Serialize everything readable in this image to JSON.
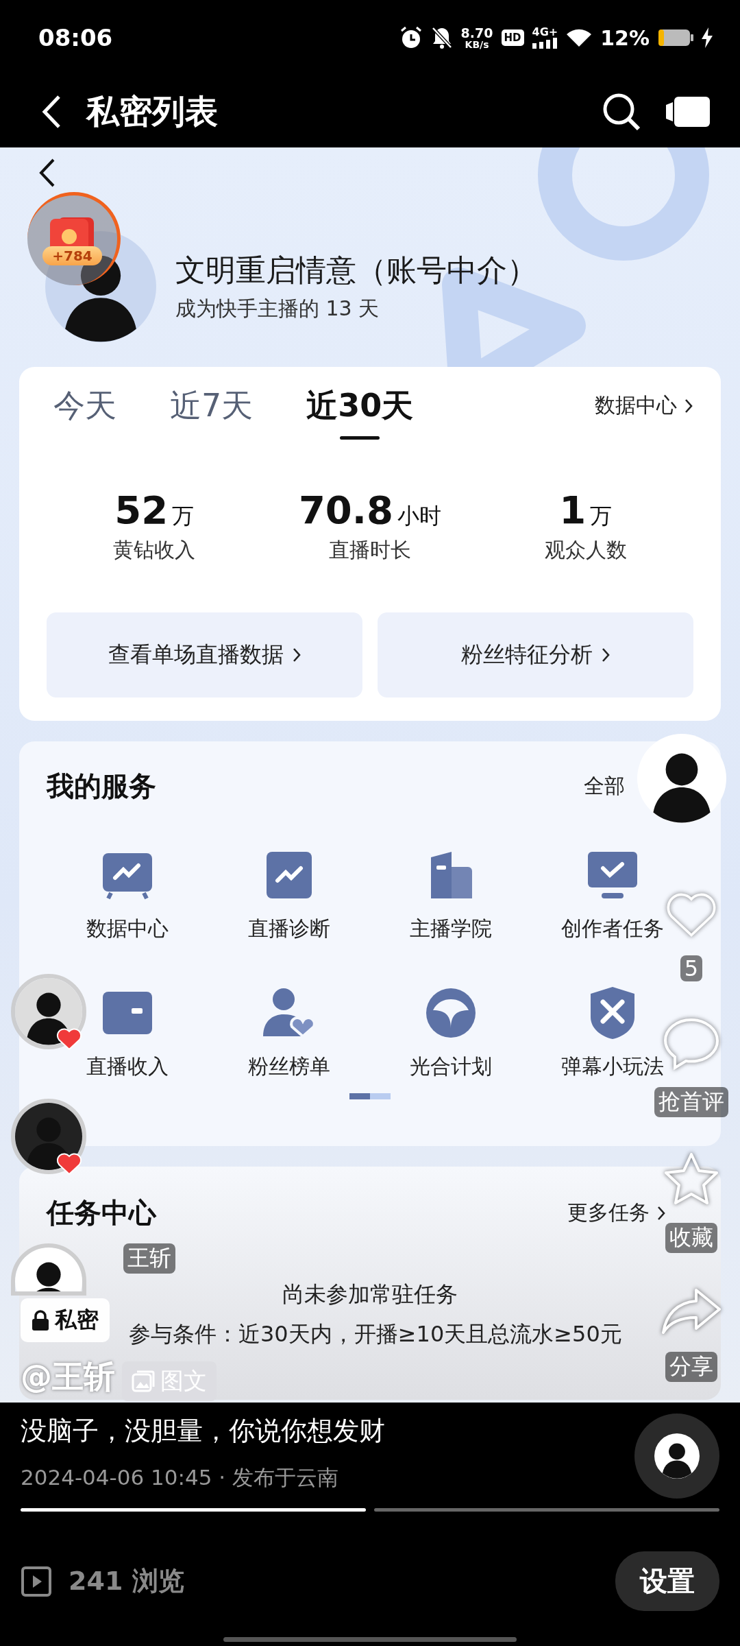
{
  "status_bar": {
    "time": "08:06",
    "net_speed": "8.70",
    "net_speed_unit": "KB/s",
    "hd": "HD",
    "network": "4G+",
    "battery": "12%"
  },
  "top_bar": {
    "title": "私密列表"
  },
  "post_image": {
    "profile": {
      "badge": "+784",
      "name": "文明重启情意（账号中介）",
      "subtitle": "成为快手主播的 13 天"
    },
    "stats_card": {
      "tabs": [
        {
          "label": "今天",
          "selected": false
        },
        {
          "label": "近7天",
          "selected": false
        },
        {
          "label": "近30天",
          "selected": true
        }
      ],
      "link": "数据中心",
      "metrics": [
        {
          "value": "52",
          "unit": "万",
          "label": "黄钻收入"
        },
        {
          "value": "70.8",
          "unit": "小时",
          "label": "直播时长"
        },
        {
          "value": "1",
          "unit": "万",
          "label": "观众人数"
        }
      ],
      "buttons": [
        "查看单场直播数据",
        "粉丝特征分析"
      ]
    },
    "services": {
      "title": "我的服务",
      "link": "全部",
      "items": [
        {
          "kind": "chart-screen",
          "label": "数据中心"
        },
        {
          "kind": "chart",
          "label": "直播诊断"
        },
        {
          "kind": "building",
          "label": "主播学院"
        },
        {
          "kind": "monitor-check",
          "label": "创作者任务"
        },
        {
          "kind": "card",
          "label": "直播收入"
        },
        {
          "kind": "user-heart",
          "label": "粉丝榜单"
        },
        {
          "kind": "circle-leaf",
          "label": "光合计划"
        },
        {
          "kind": "shield",
          "label": "弹幕小玩法"
        }
      ],
      "pages": [
        {
          "selected": true
        },
        {
          "selected": false
        }
      ]
    },
    "task_center": {
      "title": "任务中心",
      "link": "更多任务",
      "message": "尚未参加常驻任务",
      "condition": "参与条件：近30天内，开播≥10天且总流水≥50元"
    }
  },
  "overlay": {
    "viewer_name": "王斩",
    "privacy": "私密",
    "author": "@王斩",
    "post_type": "图文",
    "actions": [
      {
        "kind": "like",
        "label": "5"
      },
      {
        "kind": "comment",
        "label": "抢首评"
      },
      {
        "kind": "favorite",
        "label": "收藏"
      },
      {
        "kind": "share",
        "label": "分享"
      }
    ]
  },
  "caption": "没脑子，没胆量，你说你想发财",
  "meta": "2024-04-06 10:45 · 发布于云南",
  "slides": [
    {
      "selected": true
    },
    {
      "selected": false
    }
  ],
  "views": "241 浏览",
  "settings_button": "设置"
}
